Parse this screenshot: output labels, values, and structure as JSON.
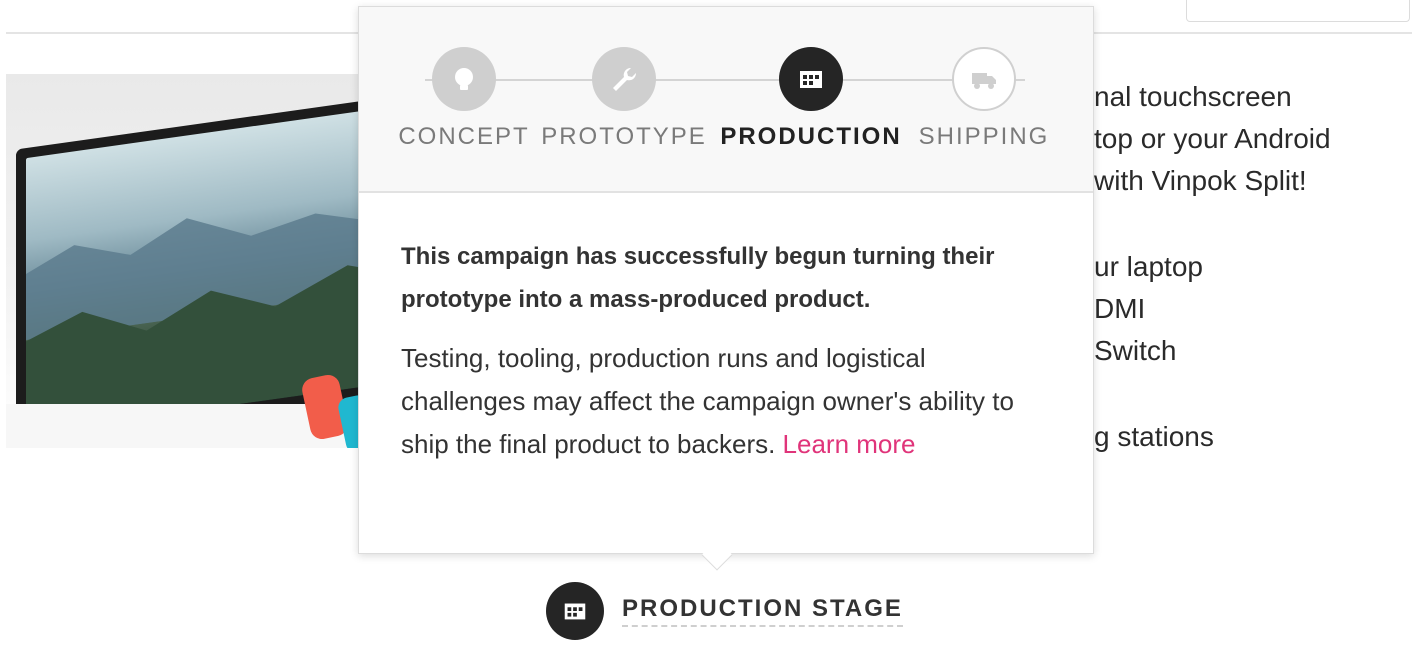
{
  "background": {
    "description_lines": [
      "nal touchscreen",
      "top or your Android",
      "with Vinpok Split!",
      "",
      "ur laptop",
      "DMI",
      "Switch",
      "",
      "g stations"
    ]
  },
  "popover": {
    "stages": [
      {
        "label": "CONCEPT",
        "icon": "lightbulb-icon",
        "state": "completed"
      },
      {
        "label": "PROTOTYPE",
        "icon": "wrench-icon",
        "state": "completed"
      },
      {
        "label": "PRODUCTION",
        "icon": "factory-icon",
        "state": "current"
      },
      {
        "label": "SHIPPING",
        "icon": "truck-icon",
        "state": "upcoming"
      }
    ],
    "headline": "This campaign has successfully begun turning their prototype into a mass-produced product.",
    "body": "Testing, tooling, production runs and logistical challenges may affect the campaign owner's ability to ship the final product to backers. ",
    "link_label": "Learn more"
  },
  "trigger": {
    "icon": "factory-icon",
    "label": "PRODUCTION STAGE"
  },
  "colors": {
    "accent_link": "#e0347a",
    "active_stage": "#252525",
    "inactive_stage": "#cfcfcf"
  }
}
